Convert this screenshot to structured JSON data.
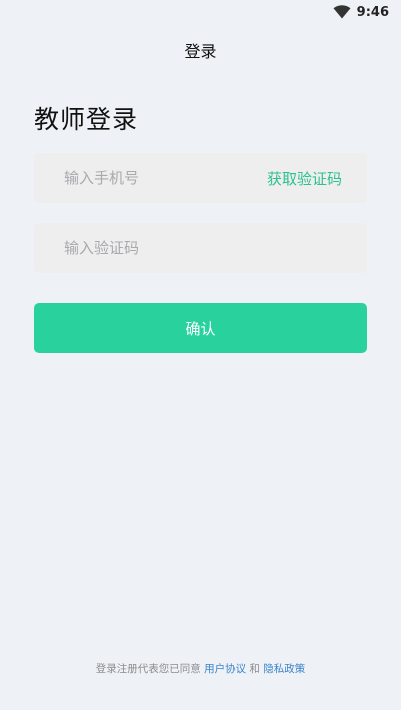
{
  "status_bar": {
    "time": "9:46",
    "wifi_icon": "wifi-icon"
  },
  "nav": {
    "title": "登录"
  },
  "heading": "教师登录",
  "phone_field": {
    "placeholder": "输入手机号",
    "value": ""
  },
  "get_code_label": "获取验证码",
  "code_field": {
    "placeholder": "输入验证码",
    "value": ""
  },
  "confirm_label": "确认",
  "footer": {
    "prefix": "登录注册代表您已同意",
    "user_agreement": "用户协议",
    "conjunction": "和",
    "privacy_policy": "隐私政策"
  },
  "colors": {
    "accent": "#29d29d",
    "link": "#3d83c9",
    "background": "#eef2f7"
  }
}
